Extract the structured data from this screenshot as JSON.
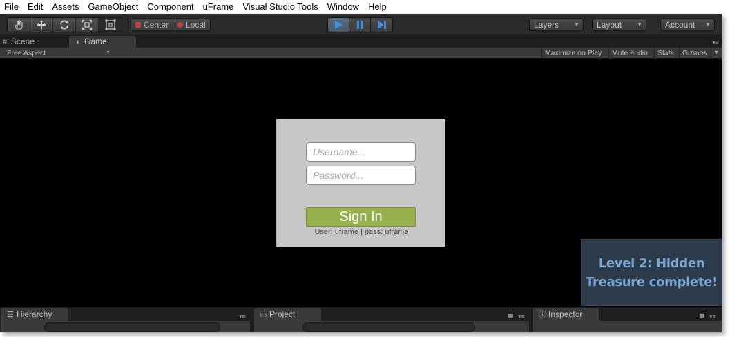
{
  "menu": {
    "items": [
      "File",
      "Edit",
      "Assets",
      "GameObject",
      "Component",
      "uFrame",
      "Visual Studio Tools",
      "Window",
      "Help"
    ]
  },
  "toolbar": {
    "tools": [
      {
        "name": "hand-tool-icon",
        "active": false
      },
      {
        "name": "move-tool-icon",
        "active": false
      },
      {
        "name": "rotate-tool-icon",
        "active": false
      },
      {
        "name": "scale-tool-icon",
        "active": false
      },
      {
        "name": "rect-tool-icon",
        "active": true
      }
    ],
    "pivot_label": "Center",
    "space_label": "Local",
    "play_icons": [
      "play-icon",
      "pause-icon",
      "step-icon"
    ],
    "layers_label": "Layers",
    "layout_label": "Layout",
    "account_label": "Account"
  },
  "tabs": {
    "scene_label": "Scene",
    "game_label": "Game"
  },
  "game_toolbar": {
    "aspect_label": "Free Aspect",
    "maximize_label": "Maximize on Play",
    "mute_label": "Mute audio",
    "stats_label": "Stats",
    "gizmos_label": "Gizmos"
  },
  "login": {
    "username_placeholder": "Username...",
    "password_placeholder": "Password...",
    "signin_label": "Sign In",
    "hint": "User: uframe | pass: uframe"
  },
  "toast": {
    "line1": "Level 2: Hidden",
    "line2": "Treasure complete!"
  },
  "bottom_panels": {
    "hierarchy_label": "Hierarchy",
    "project_label": "Project",
    "inspector_label": "Inspector"
  },
  "colors": {
    "play_active": "#5b6f86",
    "signin_button": "#95af4c",
    "toast_bg": "#2c3b4b",
    "toast_text": "#7ba6d1"
  }
}
